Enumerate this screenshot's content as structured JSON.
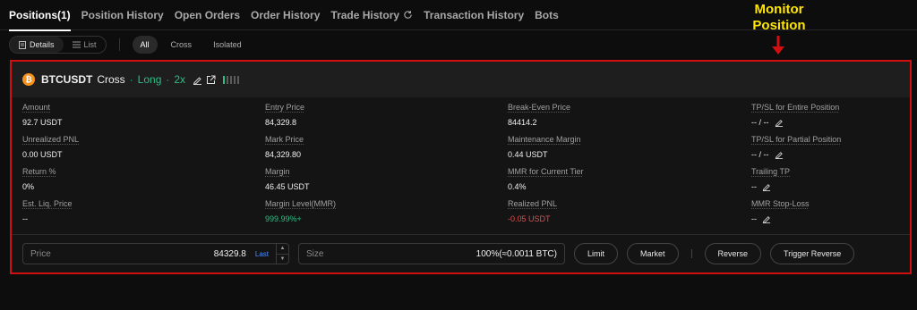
{
  "tabs": [
    {
      "label": "Positions(1)",
      "active": true
    },
    {
      "label": "Position History"
    },
    {
      "label": "Open Orders"
    },
    {
      "label": "Order History"
    },
    {
      "label": "Trade History"
    },
    {
      "label": "Transaction History"
    },
    {
      "label": "Bots"
    }
  ],
  "annotation": {
    "line1": "Monitor",
    "line2": "Position",
    "color": "#ffe600"
  },
  "view_toggle": {
    "details": "Details",
    "list": "List"
  },
  "filters": {
    "all": "All",
    "cross": "Cross",
    "isolated": "Isolated"
  },
  "position": {
    "coin_icon": "bitcoin-icon",
    "symbol": "BTCUSDT",
    "margin_mode": "Cross",
    "separator": "·",
    "side": "Long",
    "leverage": "2x",
    "risk_level_bars": 5,
    "risk_level_filled": 1
  },
  "fields": {
    "amount": {
      "label": "Amount",
      "value": "92.7 USDT"
    },
    "entry_price": {
      "label": "Entry Price",
      "value": "84,329.8"
    },
    "break_even": {
      "label": "Break-Even Price",
      "value": "84414.2"
    },
    "tpsl_entire": {
      "label": "TP/SL for Entire Position",
      "value": "-- / --"
    },
    "unrealized_pnl": {
      "label": "Unrealized PNL",
      "value": "0.00 USDT"
    },
    "mark_price": {
      "label": "Mark Price",
      "value": "84,329.80"
    },
    "maint_margin": {
      "label": "Maintenance Margin",
      "value": "0.44 USDT"
    },
    "tpsl_partial": {
      "label": "TP/SL for Partial Position",
      "value": "-- / --"
    },
    "return_pct": {
      "label": "Return %",
      "value": "0%"
    },
    "margin": {
      "label": "Margin",
      "value": "46.45 USDT"
    },
    "mmr_tier": {
      "label": "MMR for Current Tier",
      "value": "0.4%"
    },
    "trailing_tp": {
      "label": "Trailing TP",
      "value": "--"
    },
    "est_liq": {
      "label": "Est. Liq. Price",
      "value": "--"
    },
    "margin_level": {
      "label": "Margin Level(MMR)",
      "value": "999.99%+"
    },
    "realized_pnl": {
      "label": "Realized PNL",
      "value": "-0.05 USDT"
    },
    "mmr_stop": {
      "label": "MMR Stop-Loss",
      "value": "--"
    }
  },
  "order": {
    "price_placeholder": "Price",
    "price_value": "84329.8",
    "last_label": "Last",
    "size_placeholder": "Size",
    "size_value": "100%(≈0.0011 BTC)",
    "limit": "Limit",
    "market": "Market",
    "reverse": "Reverse",
    "trigger_reverse": "Trigger Reverse"
  },
  "colors": {
    "accent_green": "#2ebd85",
    "loss_red": "#e34d4d",
    "highlight_border": "#d01010",
    "link_blue": "#4a8cff"
  }
}
